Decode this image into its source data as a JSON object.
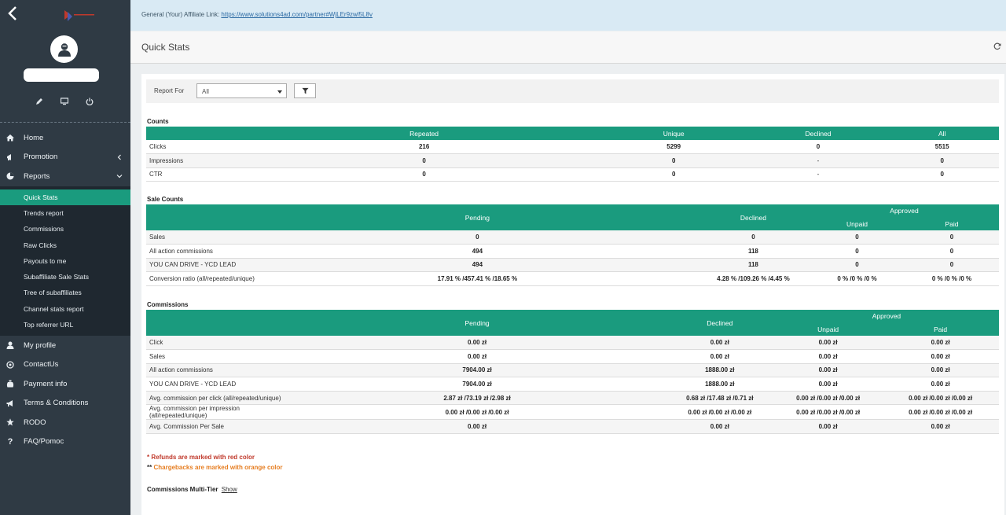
{
  "banner": {
    "label": "General (Your) Affiliate Link:",
    "link": "https://www.solutions4ad.com/partner#WjLEr9zwl5L8v"
  },
  "page": {
    "title": "Quick Stats"
  },
  "sidebar": {
    "nav": [
      {
        "label": "Home",
        "icon": "home-icon"
      },
      {
        "label": "Promotion",
        "icon": "bullhorn-icon"
      },
      {
        "label": "Reports",
        "icon": "chart-icon"
      }
    ],
    "submenu": [
      "Quick Stats",
      "Trends report",
      "Commissions",
      "Raw Clicks",
      "Payouts to me",
      "Subaffiliate Sale Stats",
      "Tree of subaffiliates",
      "Channel stats report",
      "Top referrer URL"
    ],
    "nav_bottom": [
      {
        "label": "My profile",
        "icon": "user-icon"
      },
      {
        "label": "ContactUs",
        "icon": "at-icon"
      },
      {
        "label": "Payment info",
        "icon": "money-bag-icon"
      },
      {
        "label": "Terms & Conditions",
        "icon": "megaphone-icon"
      },
      {
        "label": "RODO",
        "icon": "star-icon"
      },
      {
        "label": "FAQ/Pomoc",
        "icon": "question-icon"
      }
    ]
  },
  "filter": {
    "label": "Report For",
    "value": "All"
  },
  "counts": {
    "title": "Counts",
    "headers": [
      "",
      "Repeated",
      "Unique",
      "Declined",
      "All"
    ],
    "rows": [
      [
        "Clicks",
        "216",
        "5299",
        "0",
        "5515"
      ],
      [
        "Impressions",
        "0",
        "0",
        "-",
        "0"
      ],
      [
        "CTR",
        "0",
        "0",
        "-",
        "0"
      ]
    ]
  },
  "sale_counts": {
    "title": "Sale Counts",
    "headers": {
      "pending": "Pending",
      "declined": "Declined",
      "approved": "Approved",
      "unpaid": "Unpaid",
      "paid": "Paid"
    },
    "rows": [
      [
        "Sales",
        "0",
        "0",
        "0",
        "0"
      ],
      [
        "All action commissions",
        "494",
        "118",
        "0",
        "0"
      ],
      [
        "YOU CAN DRIVE - YCD LEAD",
        "494",
        "118",
        "0",
        "0"
      ],
      [
        "Conversion ratio (all/repeated/unique)",
        "17.91 % /457.41 % /18.65 %",
        "4.28 % /109.26 % /4.45 %",
        "0 % /0 % /0 %",
        "0 % /0 % /0 %"
      ]
    ]
  },
  "commissions": {
    "title": "Commissions",
    "headers": {
      "pending": "Pending",
      "declined": "Declined",
      "approved": "Approved",
      "unpaid": "Unpaid",
      "paid": "Paid"
    },
    "rows": [
      [
        "Click",
        "0.00 zł",
        "0.00 zł",
        "0.00 zł",
        "0.00 zł"
      ],
      [
        "Sales",
        "0.00 zł",
        "0.00 zł",
        "0.00 zł",
        "0.00 zł"
      ],
      [
        "All action commissions",
        "7904.00 zł",
        "1888.00 zł",
        "0.00 zł",
        "0.00 zł"
      ],
      [
        "YOU CAN DRIVE - YCD LEAD",
        "7904.00 zł",
        "1888.00 zł",
        "0.00 zł",
        "0.00 zł"
      ],
      [
        "Avg. commission per click (all/repeated/unique)",
        "2.87 zł /73.19 zł /2.98 zł",
        "0.68 zł /17.48 zł /0.71 zł",
        "0.00 zł /0.00 zł /0.00 zł",
        "0.00 zł /0.00 zł /0.00 zł"
      ],
      [
        "Avg. commission per impression (all/repeated/unique)",
        "0.00 zł /0.00 zł /0.00 zł",
        "0.00 zł /0.00 zł /0.00 zł",
        "0.00 zł /0.00 zł /0.00 zł",
        "0.00 zł /0.00 zł /0.00 zł"
      ],
      [
        "Avg. Commission Per Sale",
        "0.00 zł",
        "0.00 zł",
        "0.00 zł",
        "0.00 zł"
      ]
    ]
  },
  "notes": {
    "refunds_star": "*",
    "refunds": "Refunds are marked with red color",
    "chargebacks_star": "**",
    "chargebacks": "Chargebacks are marked with orange color"
  },
  "multitier": {
    "label": "Commissions Multi-Tier",
    "link": "Show"
  },
  "colors": {
    "accent": "#1a9b7e",
    "sidebar": "#2f3a44",
    "refund": "#c0392b",
    "chargeback": "#e67e22"
  }
}
